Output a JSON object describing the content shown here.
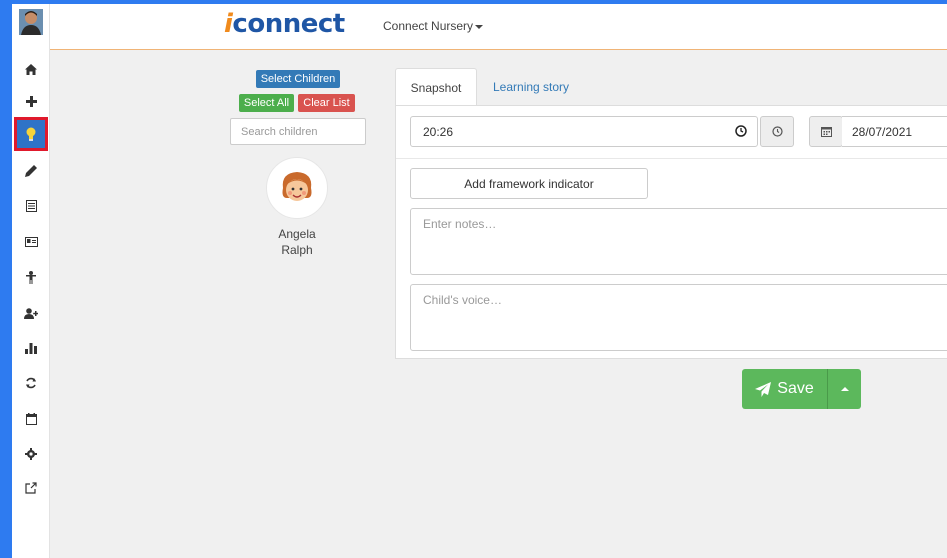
{
  "app": {
    "logo_i": "i",
    "logo_rest": "connect",
    "nursery": "Connect Nursery"
  },
  "sidebar": {
    "icons": [
      "user-avatar",
      "home-icon",
      "plus-icon",
      "lightbulb-icon",
      "pencil-icon",
      "list-icon",
      "id-card-icon",
      "child-icon",
      "add-user-icon",
      "bar-chart-icon",
      "refresh-icon",
      "calendar-icon",
      "gear-icon",
      "external-link-icon"
    ],
    "active": "lightbulb-icon"
  },
  "children_panel": {
    "select_children": "Select Children",
    "select_all": "Select All",
    "clear_list": "Clear List",
    "search_placeholder": "Search children",
    "child_first": "Angela",
    "child_last": "Ralph"
  },
  "tabs": {
    "snapshot": "Snapshot",
    "learning_story": "Learning story"
  },
  "form": {
    "time": "20:26",
    "date": "28/07/2021",
    "add_framework": "Add framework indicator",
    "notes_placeholder": "Enter notes…",
    "voice_placeholder": "Child's voice…",
    "save": "Save"
  },
  "colors": {
    "brand_orange": "#f08a1c",
    "brand_blue": "#1f56a5",
    "primary": "#337ab7",
    "success": "#5cb85c",
    "danger": "#d9534f",
    "active_outline": "#e0192c"
  }
}
